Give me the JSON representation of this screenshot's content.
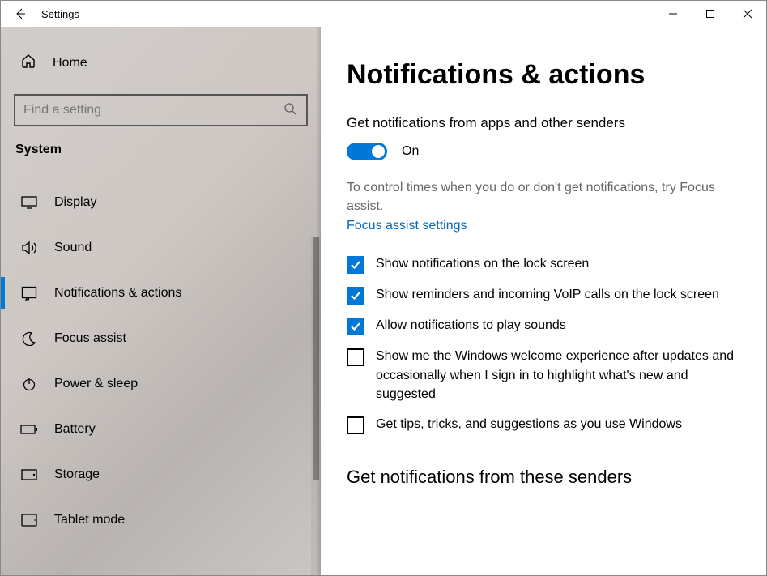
{
  "titlebar": {
    "title": "Settings"
  },
  "sidebar": {
    "home": "Home",
    "search_placeholder": "Find a setting",
    "category": "System",
    "items": [
      {
        "label": "Display"
      },
      {
        "label": "Sound"
      },
      {
        "label": "Notifications & actions"
      },
      {
        "label": "Focus assist"
      },
      {
        "label": "Power & sleep"
      },
      {
        "label": "Battery"
      },
      {
        "label": "Storage"
      },
      {
        "label": "Tablet mode"
      }
    ]
  },
  "main": {
    "heading": "Notifications & actions",
    "toggle_title": "Get notifications from apps and other senders",
    "toggle_state": "On",
    "focus_desc": "To control times when you do or don't get notifications, try Focus assist.",
    "focus_link": "Focus assist settings",
    "checks": [
      {
        "label": "Show notifications on the lock screen",
        "checked": true
      },
      {
        "label": "Show reminders and incoming VoIP calls on the lock screen",
        "checked": true
      },
      {
        "label": "Allow notifications to play sounds",
        "checked": true
      },
      {
        "label": "Show me the Windows welcome experience after updates and occasionally when I sign in to highlight what's new and suggested",
        "checked": false
      },
      {
        "label": "Get tips, tricks, and suggestions as you use Windows",
        "checked": false
      }
    ],
    "senders_heading": "Get notifications from these senders"
  }
}
